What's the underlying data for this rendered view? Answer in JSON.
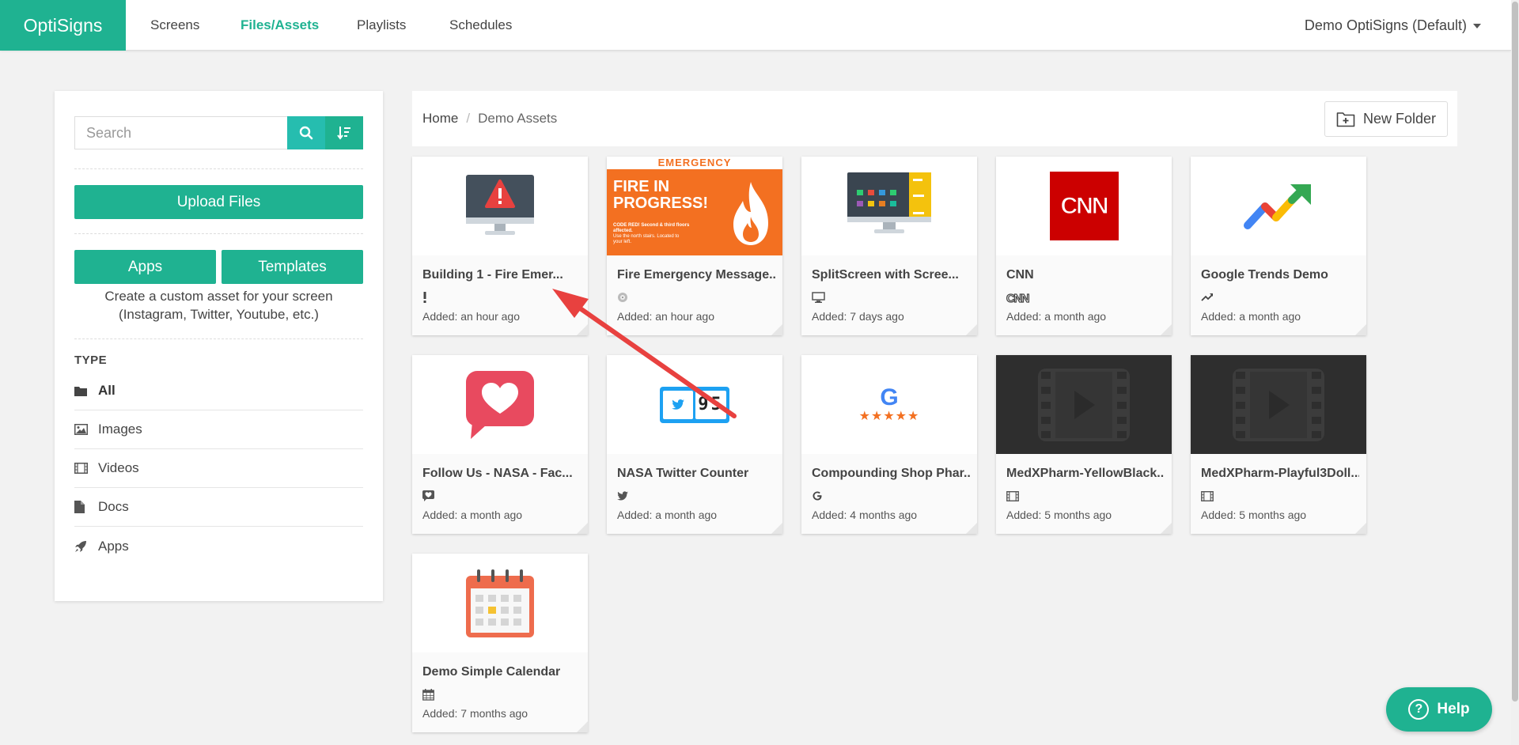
{
  "nav": {
    "brand": "OptiSigns",
    "links": [
      {
        "label": "Screens"
      },
      {
        "label": "Files/Assets"
      },
      {
        "label": "Playlists"
      },
      {
        "label": "Schedules"
      }
    ],
    "account": "Demo OptiSigns (Default)"
  },
  "sidebar": {
    "search_placeholder": "Search",
    "upload_label": "Upload Files",
    "apps_label": "Apps",
    "templates_label": "Templates",
    "help_text": "Create a custom asset for your screen (Instagram, Twitter, Youtube, etc.)",
    "type_heading": "TYPE",
    "types": [
      {
        "label": "All",
        "icon": "folder-icon"
      },
      {
        "label": "Images",
        "icon": "image-icon"
      },
      {
        "label": "Videos",
        "icon": "film-icon"
      },
      {
        "label": "Docs",
        "icon": "document-icon"
      },
      {
        "label": "Apps",
        "icon": "rocket-icon"
      }
    ]
  },
  "breadcrumb": {
    "home": "Home",
    "separator": "/",
    "current": "Demo Assets"
  },
  "new_folder_label": "New Folder",
  "assets": [
    {
      "name": "Building 1 - Fire Emer...",
      "type_icon": "exclamation-icon",
      "added": "Added: an hour ago",
      "thumb": "alert-monitor"
    },
    {
      "name": "Fire Emergency Message...",
      "type_icon": "disk-icon",
      "added": "Added: an hour ago",
      "thumb": "fire-poster",
      "thumb_title": "EMERGENCY",
      "thumb_heading_1": "FIRE IN",
      "thumb_heading_2": "PROGRESS!",
      "thumb_line_1": "CODE RED! Second & third floors affected.",
      "thumb_line_2": "Use the north stairs. Located to",
      "thumb_line_3": "your left."
    },
    {
      "name": "SplitScreen with Scree...",
      "type_icon": "monitor-icon",
      "added": "Added: 7 days ago",
      "thumb": "split-monitor"
    },
    {
      "name": "CNN",
      "type_icon": "cnn-icon",
      "added": "Added: a month ago",
      "thumb": "cnn-logo",
      "thumb_label": "CNN"
    },
    {
      "name": "Google Trends Demo",
      "type_icon": "trend-icon",
      "added": "Added: a month ago",
      "thumb": "trend-arrow"
    },
    {
      "name": "Follow Us - NASA - Fac...",
      "type_icon": "heart-bubble-icon",
      "added": "Added: a month ago",
      "thumb": "heart-bubble"
    },
    {
      "name": "NASA Twitter Counter",
      "type_icon": "twitter-icon",
      "added": "Added: a month ago",
      "thumb": "twitter-counter",
      "thumb_digits": "95"
    },
    {
      "name": "Compounding Shop Phar...",
      "type_icon": "google-icon",
      "added": "Added: 4 months ago",
      "thumb": "google-reviews",
      "thumb_label": "G",
      "thumb_stars": "★★★★★"
    },
    {
      "name": "MedXPharm-YellowBlack...",
      "type_icon": "film-icon",
      "added": "Added: 5 months ago",
      "thumb": "video"
    },
    {
      "name": "MedXPharm-Playful3Doll...",
      "type_icon": "film-icon",
      "added": "Added: 5 months ago",
      "thumb": "video"
    },
    {
      "name": "Demo Simple Calendar",
      "type_icon": "calendar-icon",
      "added": "Added: 7 months ago",
      "thumb": "calendar"
    }
  ],
  "help_label": "Help",
  "colors": {
    "brand": "#1fb291",
    "annotation_arrow": "#e8413f"
  }
}
